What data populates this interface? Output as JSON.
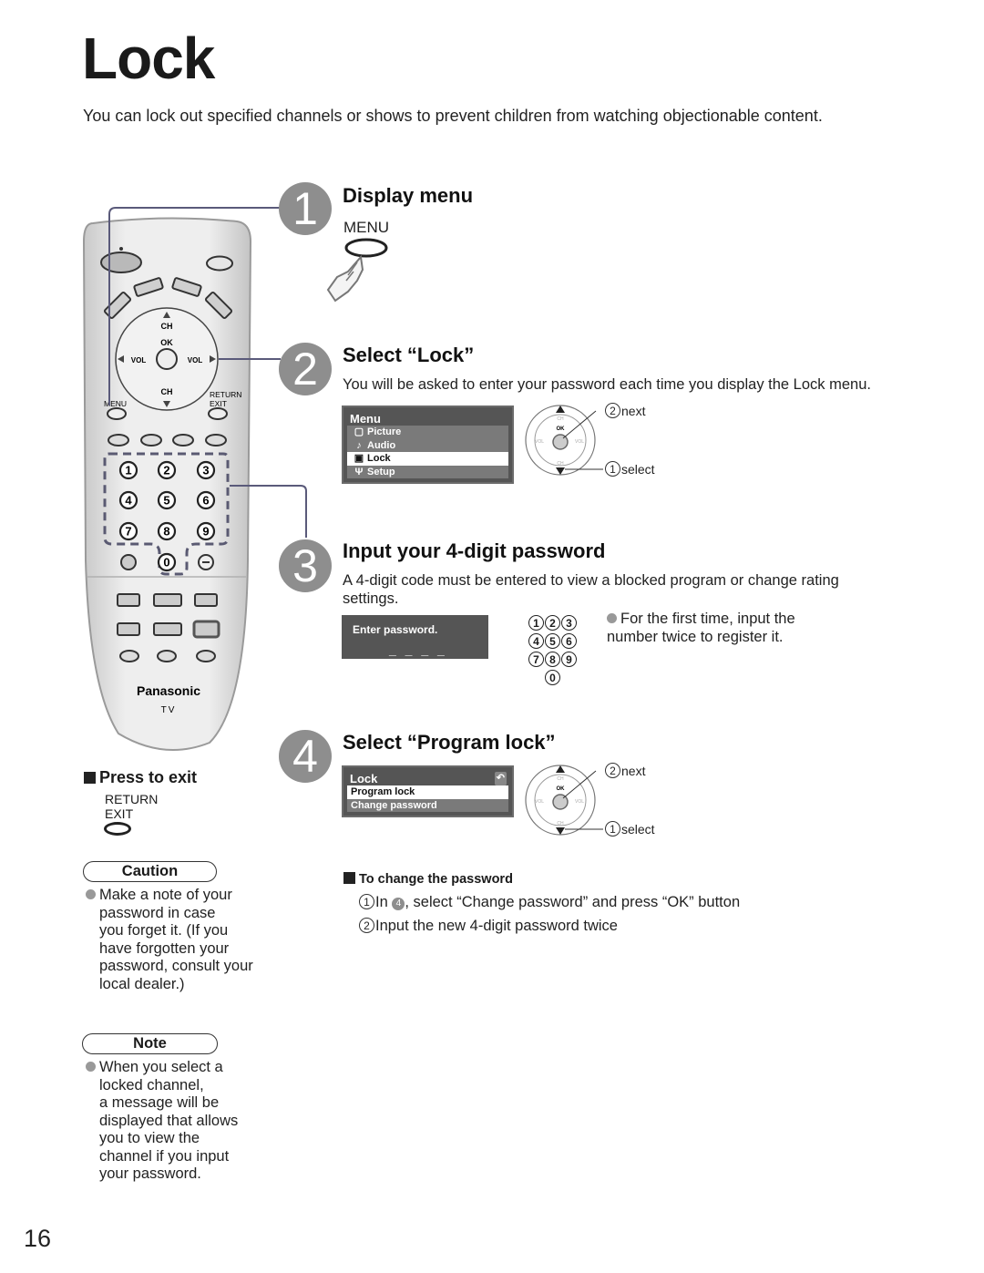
{
  "page": {
    "title": "Lock",
    "intro": "You can lock out specified channels or shows to prevent children from watching objectionable content.",
    "page_number": "16"
  },
  "remote": {
    "brand": "Panasonic",
    "model": "TV",
    "labels": {
      "ch_up": "CH",
      "ch_down": "CH",
      "ok": "OK",
      "vol_left": "VOL",
      "vol_right": "VOL",
      "menu": "MENU",
      "return": "RETURN",
      "exit": "EXIT"
    },
    "digits": [
      "1",
      "2",
      "3",
      "4",
      "5",
      "6",
      "7",
      "8",
      "9",
      "0"
    ]
  },
  "steps": [
    {
      "number": "1",
      "title": "Display menu",
      "button_label": "MENU"
    },
    {
      "number": "2",
      "title": "Select “Lock”",
      "description": "You will be asked to enter your password each time you display the Lock menu.",
      "osd": {
        "title": "Menu",
        "items": [
          {
            "label": "Picture",
            "icon": "picture-icon",
            "glyph": "▢",
            "selected": false
          },
          {
            "label": "Audio",
            "icon": "audio-icon",
            "glyph": "♪",
            "selected": false
          },
          {
            "label": "Lock",
            "icon": "lock-icon",
            "glyph": "🔒",
            "selected": true
          },
          {
            "label": "Setup",
            "icon": "setup-icon",
            "glyph": "Ψ",
            "selected": false
          }
        ]
      },
      "dpad": {
        "next_num": "2",
        "next_label": "next",
        "select_num": "1",
        "select_label": "select",
        "ok": "OK",
        "ch": "CH",
        "vol": "VOL"
      }
    },
    {
      "number": "3",
      "title": "Input your 4-digit password",
      "description": "A 4-digit code must be entered to view a blocked program or change rating settings.",
      "prompt": "Enter password.",
      "dashes": "_ _ _ _",
      "keypad": [
        [
          "1",
          "2",
          "3"
        ],
        [
          "4",
          "5",
          "6"
        ],
        [
          "7",
          "8",
          "9"
        ],
        [
          "0"
        ]
      ],
      "note": "For the first time, input the number twice to register it."
    },
    {
      "number": "4",
      "title": "Select “Program lock”",
      "osd": {
        "title": "Lock",
        "back_icon": "return-icon",
        "items": [
          {
            "label": "Program lock",
            "selected": true
          },
          {
            "label": "Change password",
            "selected": false
          }
        ]
      },
      "dpad": {
        "next_num": "2",
        "next_label": "next",
        "select_num": "1",
        "select_label": "select",
        "ok": "OK",
        "ch": "CH",
        "vol": "VOL"
      }
    }
  ],
  "change_password": {
    "heading": "To change the password",
    "items": [
      {
        "num": "1",
        "before": "In ",
        "ref": "4",
        "after": ", select “Change password” and press “OK” button"
      },
      {
        "num": "2",
        "text": "Input the new 4-digit password twice"
      }
    ]
  },
  "press_to_exit": {
    "heading": "Press to exit",
    "label_line1": "RETURN",
    "label_line2": "EXIT"
  },
  "caution": {
    "label": "Caution",
    "text": "Make a note of your password in case you forget it. (If you have forgotten your password, consult your local dealer.)",
    "lines": [
      "Make a note of your",
      "password in case",
      "you forget it. (If you",
      "have forgotten your",
      "password, consult your",
      "local dealer.)"
    ]
  },
  "note": {
    "label": "Note",
    "lines": [
      "When you select a",
      "locked channel,",
      "a message will be",
      "displayed that allows",
      "you to view the",
      "channel if you input",
      "your password."
    ]
  },
  "colors": {
    "step_circle": "#8e8e8e",
    "osd_bg": "#555555",
    "osd_row": "#7a7a7a",
    "remote_body": "#e4e4e4",
    "connector_line": "#5a5a7a"
  }
}
